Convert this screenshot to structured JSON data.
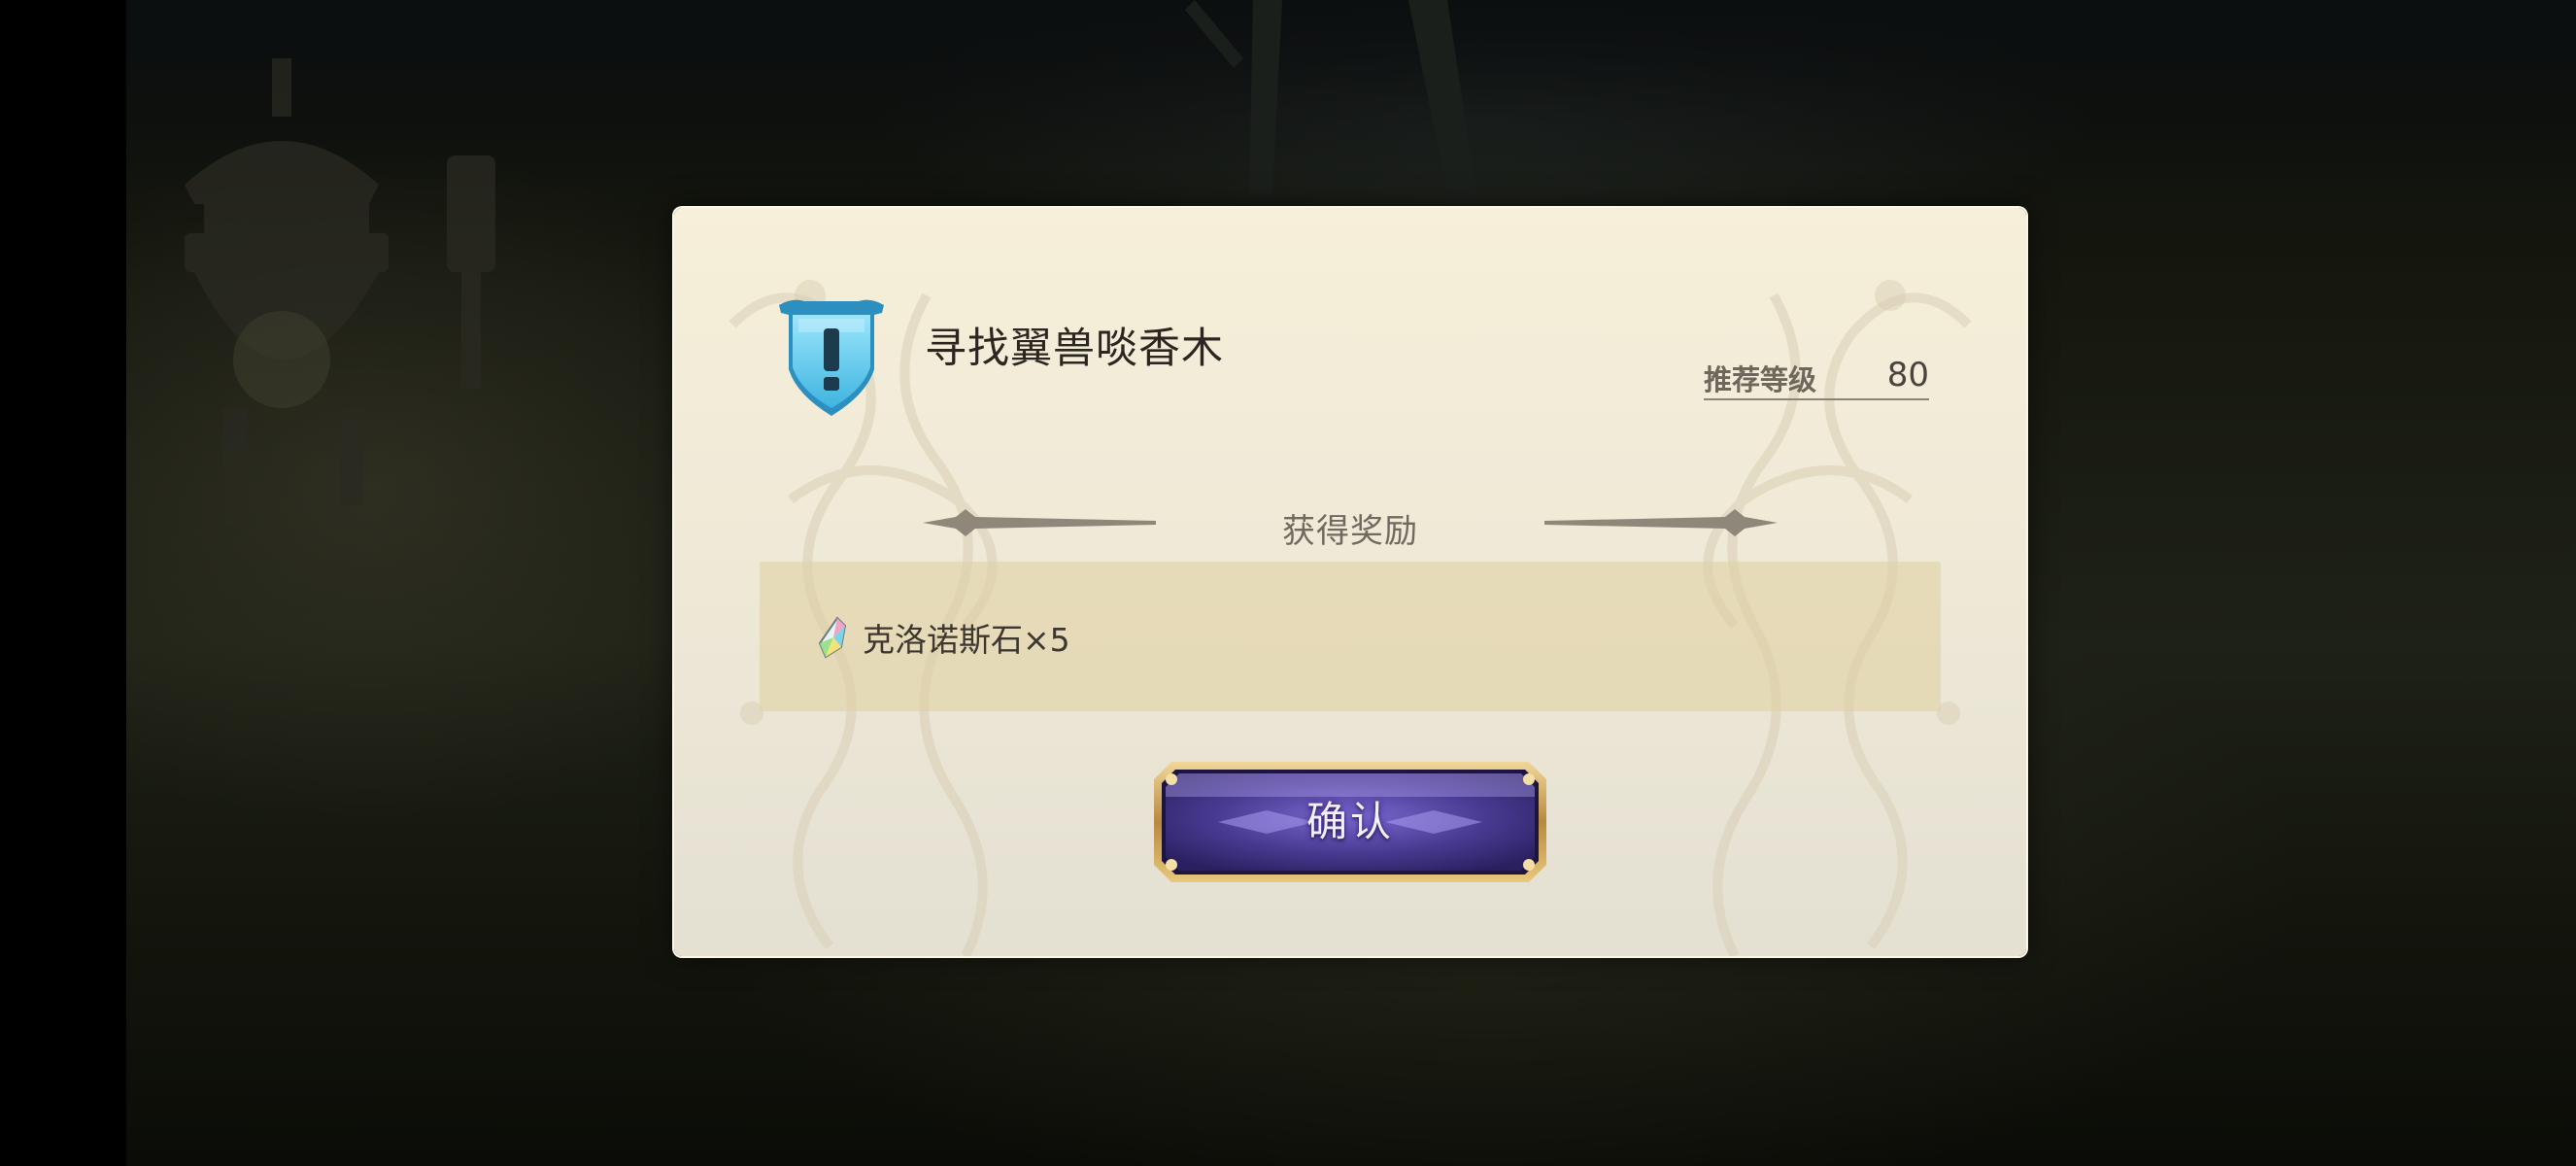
{
  "quest": {
    "title": "寻找翼兽啖香木",
    "recommended_level_label": "推荐等级",
    "recommended_level_value": "80",
    "icon": "quest-exclamation-shield-icon"
  },
  "rewards": {
    "title": "获得奖励",
    "items": [
      {
        "icon": "crystal-icon",
        "text": "克洛诺斯石×5"
      }
    ]
  },
  "actions": {
    "confirm_label": "确认"
  },
  "colors": {
    "dialog_bg": "#f1ead6",
    "reward_box": "#e6d9ad",
    "button_purple": "#4b3a8f",
    "button_gold": "#c9a45a",
    "shield_blue": "#6fd0ee"
  }
}
